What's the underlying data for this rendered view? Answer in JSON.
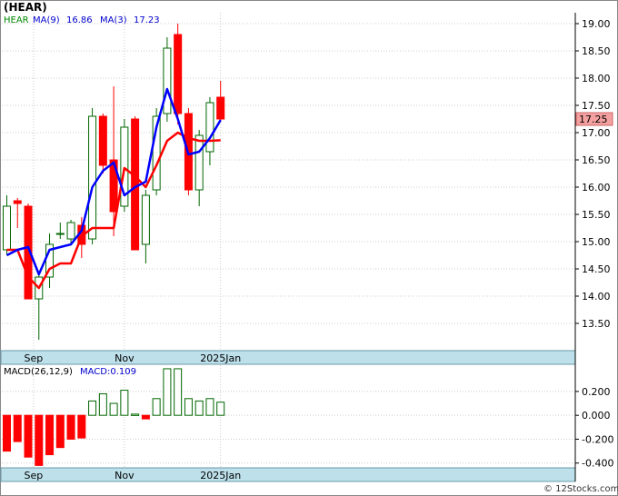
{
  "title": "(HEAR)",
  "legend": {
    "symbol": "HEAR",
    "ma9_label": "MA(9)",
    "ma9_value": "16.86",
    "ma3_label": "MA(3)",
    "ma3_value": "17.23"
  },
  "last_price_label": "17.25",
  "macd_legend": {
    "label": "MACD(26,12,9)",
    "value_label": "MACD:0.109"
  },
  "watermark": "© 12Stocks.com",
  "colors": {
    "up": "#006600",
    "down": "#ff0000",
    "ma9": "#ff0000",
    "ma3": "#0000ff",
    "axis_band": "#bde0ea",
    "price_badge": "#f4a0a0"
  },
  "chart_data": [
    {
      "type": "candlestick",
      "y_ticks": [
        13.5,
        14.0,
        14.5,
        15.0,
        15.5,
        16.0,
        16.5,
        17.0,
        17.5,
        18.0,
        18.5,
        19.0
      ],
      "y_tick_labels": [
        "13.50",
        "14.00",
        "14.50",
        "15.00",
        "15.50",
        "16.00",
        "16.50",
        "17.00",
        "17.50",
        "18.00",
        "18.50",
        "19.00"
      ],
      "ylim": [
        13.0,
        19.2
      ],
      "x_labels": [
        {
          "index": 5,
          "label": "Sep"
        },
        {
          "index": 22,
          "label": "Nov"
        },
        {
          "index": 40,
          "label": "2025Jan"
        }
      ],
      "candles": [
        {
          "o": 14.85,
          "h": 15.85,
          "l": 14.75,
          "c": 15.65
        },
        {
          "o": 15.75,
          "h": 15.8,
          "l": 15.25,
          "c": 15.7
        },
        {
          "o": 15.65,
          "h": 15.7,
          "l": 13.95,
          "c": 13.95
        },
        {
          "o": 13.95,
          "h": 14.4,
          "l": 13.2,
          "c": 14.35
        },
        {
          "o": 14.35,
          "h": 15.15,
          "l": 14.15,
          "c": 14.95
        },
        {
          "o": 15.15,
          "h": 15.35,
          "l": 15.05,
          "c": 15.15
        },
        {
          "o": 15.05,
          "h": 15.4,
          "l": 14.95,
          "c": 15.35
        },
        {
          "o": 15.3,
          "h": 15.45,
          "l": 14.7,
          "c": 14.95
        },
        {
          "o": 15.05,
          "h": 17.45,
          "l": 14.95,
          "c": 17.3
        },
        {
          "o": 17.3,
          "h": 17.35,
          "l": 16.25,
          "c": 16.4
        },
        {
          "o": 16.5,
          "h": 17.85,
          "l": 15.1,
          "c": 15.55
        },
        {
          "o": 15.65,
          "h": 17.25,
          "l": 15.55,
          "c": 17.1
        },
        {
          "o": 17.25,
          "h": 17.3,
          "l": 14.85,
          "c": 14.85
        },
        {
          "o": 14.95,
          "h": 15.95,
          "l": 14.6,
          "c": 15.85
        },
        {
          "o": 15.95,
          "h": 17.45,
          "l": 15.85,
          "c": 17.3
        },
        {
          "o": 17.35,
          "h": 18.75,
          "l": 17.2,
          "c": 18.55
        },
        {
          "o": 18.8,
          "h": 19.0,
          "l": 17.15,
          "c": 17.35
        },
        {
          "o": 17.35,
          "h": 17.45,
          "l": 15.85,
          "c": 15.95
        },
        {
          "o": 15.95,
          "h": 17.05,
          "l": 15.65,
          "c": 16.95
        },
        {
          "o": 16.65,
          "h": 17.65,
          "l": 16.4,
          "c": 17.55
        },
        {
          "o": 17.65,
          "h": 17.95,
          "l": 17.2,
          "c": 17.25
        }
      ],
      "ma9": [
        14.85,
        14.85,
        14.35,
        14.15,
        14.5,
        14.6,
        14.6,
        15.1,
        15.25,
        15.25,
        15.25,
        16.35,
        16.2,
        16.0,
        16.4,
        16.85,
        17.0,
        16.9,
        16.85,
        16.85,
        16.86
      ],
      "ma3": [
        14.75,
        14.85,
        14.9,
        14.4,
        14.85,
        14.9,
        14.95,
        15.2,
        16.0,
        16.3,
        16.45,
        15.85,
        16.0,
        16.1,
        17.1,
        17.8,
        17.25,
        16.6,
        16.65,
        16.9,
        17.23
      ]
    },
    {
      "type": "bar",
      "name": "MACD(26,12,9)",
      "y_ticks": [
        -0.4,
        -0.2,
        0.0,
        0.2
      ],
      "y_tick_labels": [
        "-0.400",
        "-0.200",
        "0.000",
        "0.200"
      ],
      "ylim": [
        -0.44,
        0.42
      ],
      "values": [
        -0.3,
        -0.22,
        -0.35,
        -0.42,
        -0.33,
        -0.27,
        -0.2,
        -0.19,
        0.12,
        0.18,
        0.1,
        0.21,
        0.01,
        -0.03,
        0.14,
        0.39,
        0.39,
        0.14,
        0.12,
        0.14,
        0.11
      ]
    }
  ]
}
